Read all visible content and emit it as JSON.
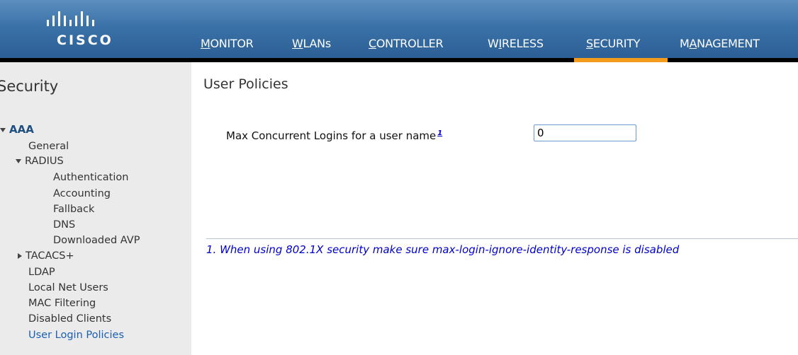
{
  "brand": {
    "logo_text": "CISCO"
  },
  "nav": {
    "items": [
      {
        "label": "MONITOR",
        "underline": "M",
        "rest": "ONITOR"
      },
      {
        "label": "WLANs",
        "underline": "W",
        "rest": "LANs"
      },
      {
        "label": "CONTROLLER",
        "underline": "C",
        "rest": "ONTROLLER"
      },
      {
        "label": "WIRELESS",
        "pre": "W",
        "underline": "I",
        "rest": "RELESS"
      },
      {
        "label": "SECURITY",
        "underline": "S",
        "rest": "ECURITY"
      },
      {
        "label": "MANAGEMENT",
        "pre": "M",
        "underline": "A",
        "rest": "NAGEMENT"
      }
    ],
    "active": "SECURITY",
    "active_color": "#f29b1c"
  },
  "sidebar": {
    "title": "Security",
    "aaa": "AAA",
    "general": "General",
    "radius": "RADIUS",
    "radius_items": [
      "Authentication",
      "Accounting",
      "Fallback",
      "DNS",
      "Downloaded AVP"
    ],
    "tacacs": "TACACS+",
    "items": [
      "LDAP",
      "Local Net Users",
      "MAC Filtering",
      "Disabled Clients",
      "User Login Policies"
    ]
  },
  "main": {
    "title": "User Policies",
    "max_logins_label": "Max Concurrent Logins for a user name",
    "footnote_mark": "1",
    "max_logins_value": "0",
    "footnote": "1. When using 802.1X security make sure max-login-ignore-identity-response is disabled"
  }
}
